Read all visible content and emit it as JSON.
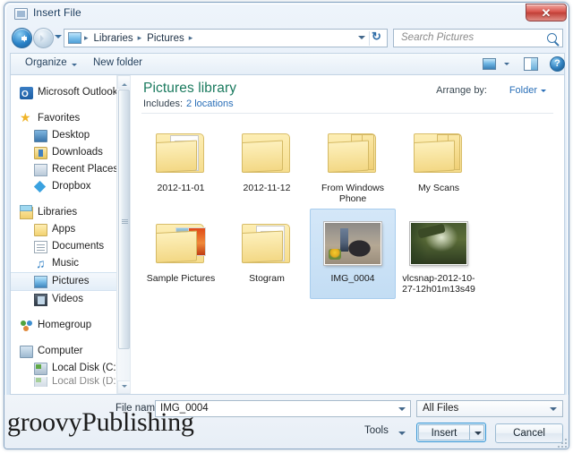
{
  "window": {
    "title": "Insert File",
    "close_label": "✕"
  },
  "navbar": {
    "breadcrumbs": [
      "Libraries",
      "Pictures"
    ],
    "separator": "▸",
    "back_icon": "back-arrow-icon",
    "forward_icon": "forward-arrow-icon",
    "refresh_icon": "refresh-icon",
    "search": {
      "placeholder": "Search Pictures",
      "value": "",
      "icon": "search-icon"
    }
  },
  "toolbar": {
    "organize": "Organize",
    "new_folder": "New folder",
    "view_icon": "view-mode-icon",
    "preview_pane_icon": "preview-pane-icon",
    "help_icon": "help-icon"
  },
  "sidebar": {
    "items": [
      {
        "label": "Microsoft Outlook",
        "icon": "outlook-icon",
        "level": "top",
        "selected": false
      },
      {
        "label": "Favorites",
        "icon": "star-icon",
        "level": "top",
        "selected": false
      },
      {
        "label": "Desktop",
        "icon": "desktop-icon",
        "level": "child",
        "selected": false
      },
      {
        "label": "Downloads",
        "icon": "downloads-icon",
        "level": "child",
        "selected": false
      },
      {
        "label": "Recent Places",
        "icon": "recent-places-icon",
        "level": "child",
        "selected": false
      },
      {
        "label": "Dropbox",
        "icon": "dropbox-icon",
        "level": "child",
        "selected": false
      },
      {
        "label": "Libraries",
        "icon": "libraries-icon",
        "level": "top",
        "selected": false
      },
      {
        "label": "Apps",
        "icon": "apps-folder-icon",
        "level": "child",
        "selected": false
      },
      {
        "label": "Documents",
        "icon": "documents-icon",
        "level": "child",
        "selected": false
      },
      {
        "label": "Music",
        "icon": "music-icon",
        "level": "child",
        "selected": false
      },
      {
        "label": "Pictures",
        "icon": "pictures-icon",
        "level": "child",
        "selected": true
      },
      {
        "label": "Videos",
        "icon": "videos-icon",
        "level": "child",
        "selected": false
      },
      {
        "label": "Homegroup",
        "icon": "homegroup-icon",
        "level": "top",
        "selected": false
      },
      {
        "label": "Computer",
        "icon": "computer-icon",
        "level": "top",
        "selected": false
      },
      {
        "label": "Local Disk (C:)",
        "icon": "disk-icon",
        "level": "child",
        "selected": false
      },
      {
        "label": "Local Disk (D:)",
        "icon": "disk-icon",
        "level": "child",
        "selected": false
      }
    ]
  },
  "content": {
    "library_title": "Pictures library",
    "includes_label": "Includes:",
    "includes_link": "2 locations",
    "arrange_label": "Arrange by:",
    "arrange_value": "Folder",
    "items": [
      {
        "label": "2012-11-01",
        "type": "folder-document",
        "selected": false
      },
      {
        "label": "2012-11-12",
        "type": "folder-tab",
        "selected": false
      },
      {
        "label": "From Windows Phone",
        "type": "folder-stack",
        "selected": false
      },
      {
        "label": "My Scans",
        "type": "folder-stack",
        "selected": false
      },
      {
        "label": "Sample Pictures",
        "type": "folder-photos",
        "selected": false
      },
      {
        "label": "Stogram",
        "type": "folder-document",
        "selected": false
      },
      {
        "label": "IMG_0004",
        "type": "photo-street",
        "selected": true
      },
      {
        "label": "vlcsnap-2012-10-27-12h01m13s49",
        "type": "photo-park",
        "selected": false
      }
    ]
  },
  "bottom": {
    "filename_label": "File name:",
    "filename_value": "IMG_0004",
    "filetype_value": "All Files",
    "tools_label": "Tools",
    "insert_label": "Insert",
    "cancel_label": "Cancel"
  },
  "watermark": {
    "text": "groovyPublishing"
  },
  "colors": {
    "accent_blue": "#2a6fb8",
    "library_green": "#1a7a5e",
    "selection_blue": "#c3ddf4",
    "close_red": "#c13f37"
  }
}
